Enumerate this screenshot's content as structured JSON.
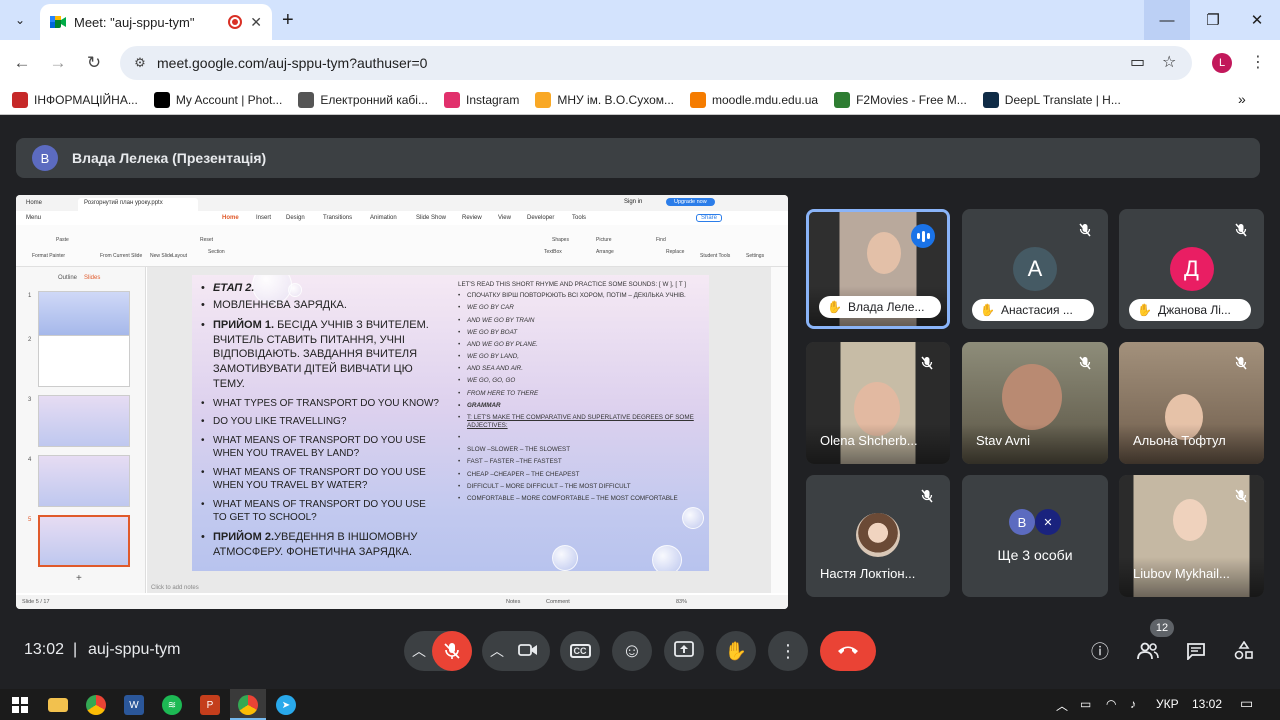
{
  "browser": {
    "tab_title": "Meet: \"auj-sppu-tym\"",
    "url": "meet.google.com/auj-sppu-tym?authuser=0",
    "profile_initial": "L",
    "bookmarks": [
      {
        "label": "ІНФОРМАЦІЙНА...",
        "color": "#c62828"
      },
      {
        "label": "My Account | Phot...",
        "color": "#000000"
      },
      {
        "label": "Електронний кабі...",
        "color": "#555555"
      },
      {
        "label": "Instagram",
        "color": "#e1306c"
      },
      {
        "label": "МНУ ім. В.О.Сухом...",
        "color": "#f9a825"
      },
      {
        "label": "moodle.mdu.edu.ua",
        "color": "#f57c00"
      },
      {
        "label": "F2Movies - Free M...",
        "color": "#2e7d32"
      },
      {
        "label": "DeepL Translate | H...",
        "color": "#0f2b46"
      }
    ]
  },
  "presenter": {
    "initial": "В",
    "label": "Влада Лелека (Презентація)"
  },
  "ppt": {
    "tabs": [
      "Home",
      "Розгорнутий план уроку.pptx"
    ],
    "signin": "Sign in",
    "upgrade": "Upgrade now",
    "menu": [
      "Menu",
      "Home",
      "Insert",
      "Design",
      "Transitions",
      "Animation",
      "Slide Show",
      "Review",
      "View",
      "Developer",
      "Tools"
    ],
    "share": "Share",
    "ribbon": [
      "Format Painter",
      "Paste",
      "From Current Slide",
      "New Slide",
      "Layout",
      "Reset",
      "Section",
      "Shapes",
      "Picture",
      "TextBox",
      "Arrange",
      "Find",
      "Replace",
      "Student Tools",
      "Settings"
    ],
    "panel_tabs": [
      "Outline",
      "Slides"
    ],
    "slide_numbers": [
      "1",
      "2",
      "3",
      "4",
      "5"
    ],
    "notes_placeholder": "Click to add notes",
    "status_slide": "Slide 5 / 17",
    "status_notes": "Notes",
    "status_comment": "Comment",
    "status_zoom": "83%",
    "slide_left": [
      {
        "text": "ЕТАП 2.",
        "bold": true
      },
      {
        "text": "МОВЛЕННЄВА ЗАРЯДКА.",
        "bold": false
      },
      {
        "text_bold": "ПРИЙОМ 1.",
        "text": " БЕСІДА УЧНІВ З ВЧИТЕЛЕМ. ВЧИТЕЛЬ СТАВИТЬ ПИТАННЯ, УЧНІ ВІДПОВІДАЮТЬ. ЗАВДАННЯ ВЧИТЕЛЯ ЗАМОТИВУВАТИ ДІТЕЙ ВИВЧАТИ ЦЮ ТЕМУ."
      },
      {
        "text": "WHAT TYPES OF TRANSPORT DO YOU KNOW?"
      },
      {
        "text": "DO YOU LIKE TRAVELLING?"
      },
      {
        "text": "WHAT MEANS OF TRANSPORT DO YOU USE WHEN YOU TRAVEL BY LAND?"
      },
      {
        "text": "WHAT MEANS OF TRANSPORT DO YOU USE WHEN YOU TRAVEL BY WATER?"
      },
      {
        "text": "WHAT MEANS OF TRANSPORT DO YOU USE TO GET TO SCHOOL?"
      },
      {
        "text_bold": "ПРИЙОМ 2.",
        "text": "УВЕДЕННЯ В ІНШОМОВНУ АТМОСФЕРУ. ФОНЕТИЧНА ЗАРЯДКА."
      }
    ],
    "slide_right_intro": "LET'S READ THIS SHORT RHYME AND PRACTICE SOME SOUNDS: [ W ], [ T ]",
    "slide_right": [
      "СПОЧАТКУ ВІРШ ПОВТОРЮЮТЬ ВСІ ХОРОМ, ПОТІМ – ДЕКІЛЬКА УЧНІВ.",
      "WE GO BY CAR",
      "AND WE GO BY TRAIN",
      "WE GO BY BOAT",
      "AND WE GO BY PLANE.",
      "WE GO BY LAND,",
      "AND SEA AND AIR.",
      "WE GO, GO, GO",
      "FROM HERE TO THERE",
      "GRAMMAR",
      "T: LET'S MAKE THE COMPARATIVE AND SUPERLATIVE DEGREES OF SOME ADJECTIVES:",
      "",
      "SLOW –SLOWER – THE SLOWEST",
      "FAST – FASTER –THE FASTEST",
      "CHEAP –CHEAPER – THE CHEAPEST",
      "DIFFICULT – MORE DIFFICULT – THE MOST DIFFICULT",
      "COMFORTABLE – MORE COMFORTABLE – THE MOST COMFORTABLE"
    ]
  },
  "participants": [
    {
      "name": "Влада Леле...",
      "type": "video",
      "speaking": true
    },
    {
      "name": "Анастасия ...",
      "type": "avatar",
      "initial": "А",
      "color": "#455a64"
    },
    {
      "name": "Джанова Лі...",
      "type": "avatar",
      "initial": "Д",
      "color": "#e91e63"
    },
    {
      "name": "Olena Shcherb...",
      "type": "video"
    },
    {
      "name": "Stav Avni",
      "type": "video"
    },
    {
      "name": "Альона Тофтул",
      "type": "video"
    },
    {
      "name": "Настя Локтіон...",
      "type": "photo"
    },
    {
      "name": "Ще 3 особи",
      "type": "group",
      "initial": "В"
    },
    {
      "name": "Liubov Mykhail...",
      "type": "video"
    }
  ],
  "meeting": {
    "time": "13:02",
    "separator": "|",
    "code": "auj-sppu-tym",
    "people_count": "12"
  },
  "taskbar": {
    "language": "УКР",
    "time": "13:02"
  },
  "colors": {
    "end_call": "#ea4335",
    "speaking": "#1a73e8",
    "tab_bar": "#d3e3fd"
  }
}
